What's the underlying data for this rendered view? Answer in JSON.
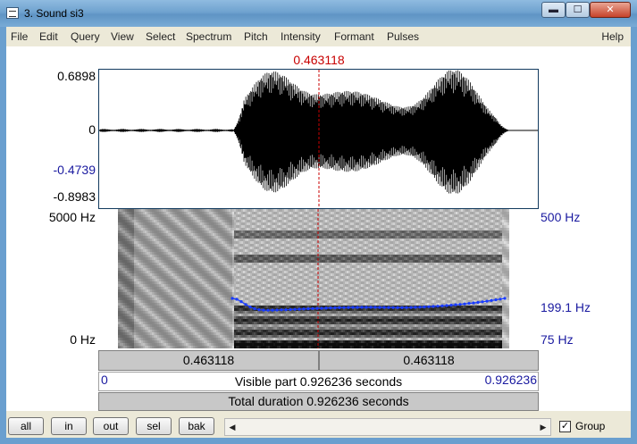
{
  "window": {
    "title": "3. Sound si3",
    "min_glyph": "▬",
    "max_glyph": "☐",
    "close_glyph": "✕"
  },
  "menu": {
    "items": [
      "File",
      "Edit",
      "Query",
      "View",
      "Select",
      "Spectrum",
      "Pitch",
      "Intensity",
      "Formant",
      "Pulses"
    ],
    "help": "Help"
  },
  "waveform": {
    "cursor_time": "0.463118",
    "y_max": "0.6898",
    "y_zero": "0",
    "y_cursor": "-0.4739",
    "y_min": "-0.8983"
  },
  "spectrogram": {
    "freq_top": "5000 Hz",
    "freq_bottom": "0 Hz",
    "pitch_top": "500 Hz",
    "pitch_value": "199.1 Hz",
    "pitch_bottom": "75 Hz"
  },
  "bars": {
    "selection_left": "0.463118",
    "selection_right": "0.463118",
    "visible_start": "0",
    "visible_text": "Visible part 0.926236 seconds",
    "visible_end": "0.926236",
    "total_text": "Total duration 0.926236 seconds"
  },
  "toolbar": {
    "all": "all",
    "in": "in",
    "out": "out",
    "sel": "sel",
    "bak": "bak",
    "scroll_left_glyph": "◀",
    "scroll_right_glyph": "▶",
    "group_label": "Group",
    "group_checked": "✓"
  },
  "colors": {
    "cursor": "#c80000",
    "pitch": "#1a3cff",
    "pitch_labels": "#1a1aa0"
  }
}
